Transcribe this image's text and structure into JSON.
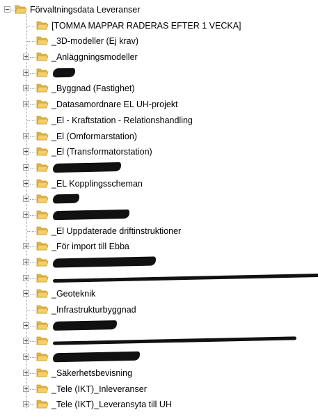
{
  "root": {
    "label": "Förvaltningsdata Leveranser",
    "expanded": true
  },
  "items": [
    {
      "label": "[TOMMA MAPPAR RADERAS EFTER 1 VECKA]",
      "expandable": false,
      "redacted": false
    },
    {
      "label": "_3D-modeller (Ej krav)",
      "expandable": false,
      "redacted": false
    },
    {
      "label": "_Anläggningsmodeller",
      "expandable": true,
      "redacted": false
    },
    {
      "label": "",
      "expandable": true,
      "redacted": true
    },
    {
      "label": "_Byggnad (Fastighet)",
      "expandable": true,
      "redacted": false
    },
    {
      "label": "_Datasamordnare EL UH-projekt",
      "expandable": true,
      "redacted": false
    },
    {
      "label": "_El - Kraftstation - Relationshandling",
      "expandable": false,
      "redacted": false
    },
    {
      "label": "_El (Omformarstation)",
      "expandable": true,
      "redacted": false
    },
    {
      "label": "_El (Transformatorstation)",
      "expandable": true,
      "redacted": false
    },
    {
      "label": "",
      "expandable": true,
      "redacted": true
    },
    {
      "label": "_EL Kopplingsscheman",
      "expandable": true,
      "redacted": false
    },
    {
      "label": "",
      "expandable": true,
      "redacted": true
    },
    {
      "label": "",
      "expandable": true,
      "redacted": true
    },
    {
      "label": "_El Uppdaterade driftinstruktioner",
      "expandable": false,
      "redacted": false
    },
    {
      "label": "_För import till Ebba",
      "expandable": true,
      "redacted": false
    },
    {
      "label": "",
      "expandable": true,
      "redacted": true
    },
    {
      "label": "",
      "expandable": true,
      "redacted": true
    },
    {
      "label": "_Geoteknik",
      "expandable": true,
      "redacted": false
    },
    {
      "label": "_Infrastrukturbyggnad",
      "expandable": false,
      "redacted": false
    },
    {
      "label": "",
      "expandable": true,
      "redacted": true
    },
    {
      "label": "",
      "expandable": true,
      "redacted": true
    },
    {
      "label": "",
      "expandable": true,
      "redacted": true
    },
    {
      "label": "_Säkerhetsbevisning",
      "expandable": true,
      "redacted": false
    },
    {
      "label": "_Tele (IKT)_Inleveranser",
      "expandable": true,
      "redacted": false
    },
    {
      "label": "_Tele (IKT)_Leveransyta till UH",
      "expandable": true,
      "redacted": false
    }
  ],
  "colors": {
    "folder_front": "#f3cf6b",
    "folder_back": "#e2b443",
    "folder_edge": "#c79a2e",
    "guide_line": "#a0a0a0"
  },
  "icons": {
    "expander_expanded": "minus-box-icon",
    "expander_collapsed": "plus-box-icon",
    "folder": "folder-icon"
  }
}
